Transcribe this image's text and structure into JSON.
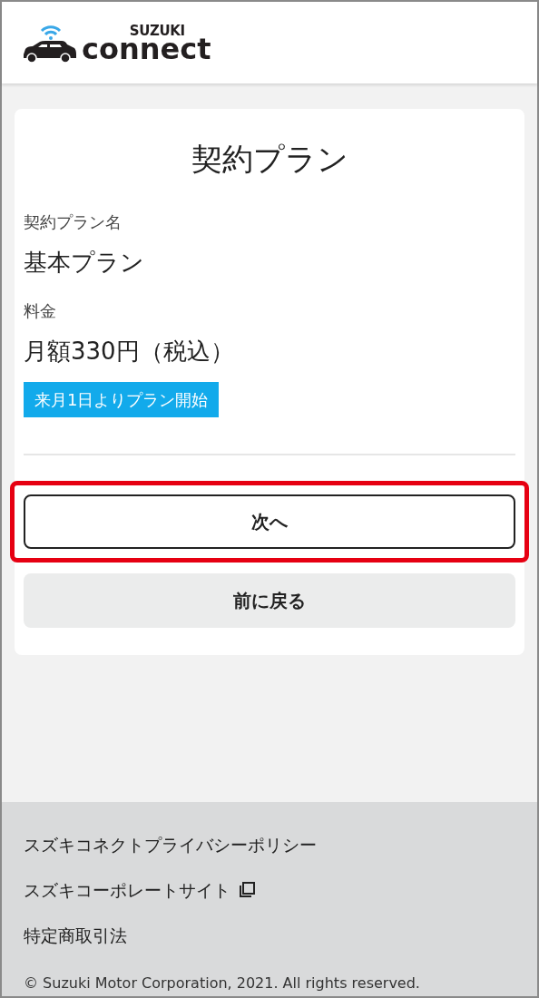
{
  "header": {
    "logo_top": "SUZUKI",
    "logo_bottom": "connect"
  },
  "card": {
    "title": "契約プラン",
    "fields": [
      {
        "label": "契約プラン名",
        "value": "基本プラン"
      },
      {
        "label": "料金",
        "value": "月額330円（税込）"
      }
    ],
    "badge": "来月1日よりプラン開始",
    "buttons": [
      {
        "label": "次へ",
        "kind": "primary",
        "highlighted": true
      },
      {
        "label": "前に戻る",
        "kind": "secondary",
        "highlighted": false
      }
    ]
  },
  "footer": {
    "links": [
      {
        "label": "スズキコネクトプライバシーポリシー",
        "external": false
      },
      {
        "label": "スズキコーポレートサイト",
        "external": true
      },
      {
        "label": "特定商取引法",
        "external": false
      }
    ],
    "copyright": "© Suzuki Motor Corporation, 2021. All rights reserved."
  }
}
